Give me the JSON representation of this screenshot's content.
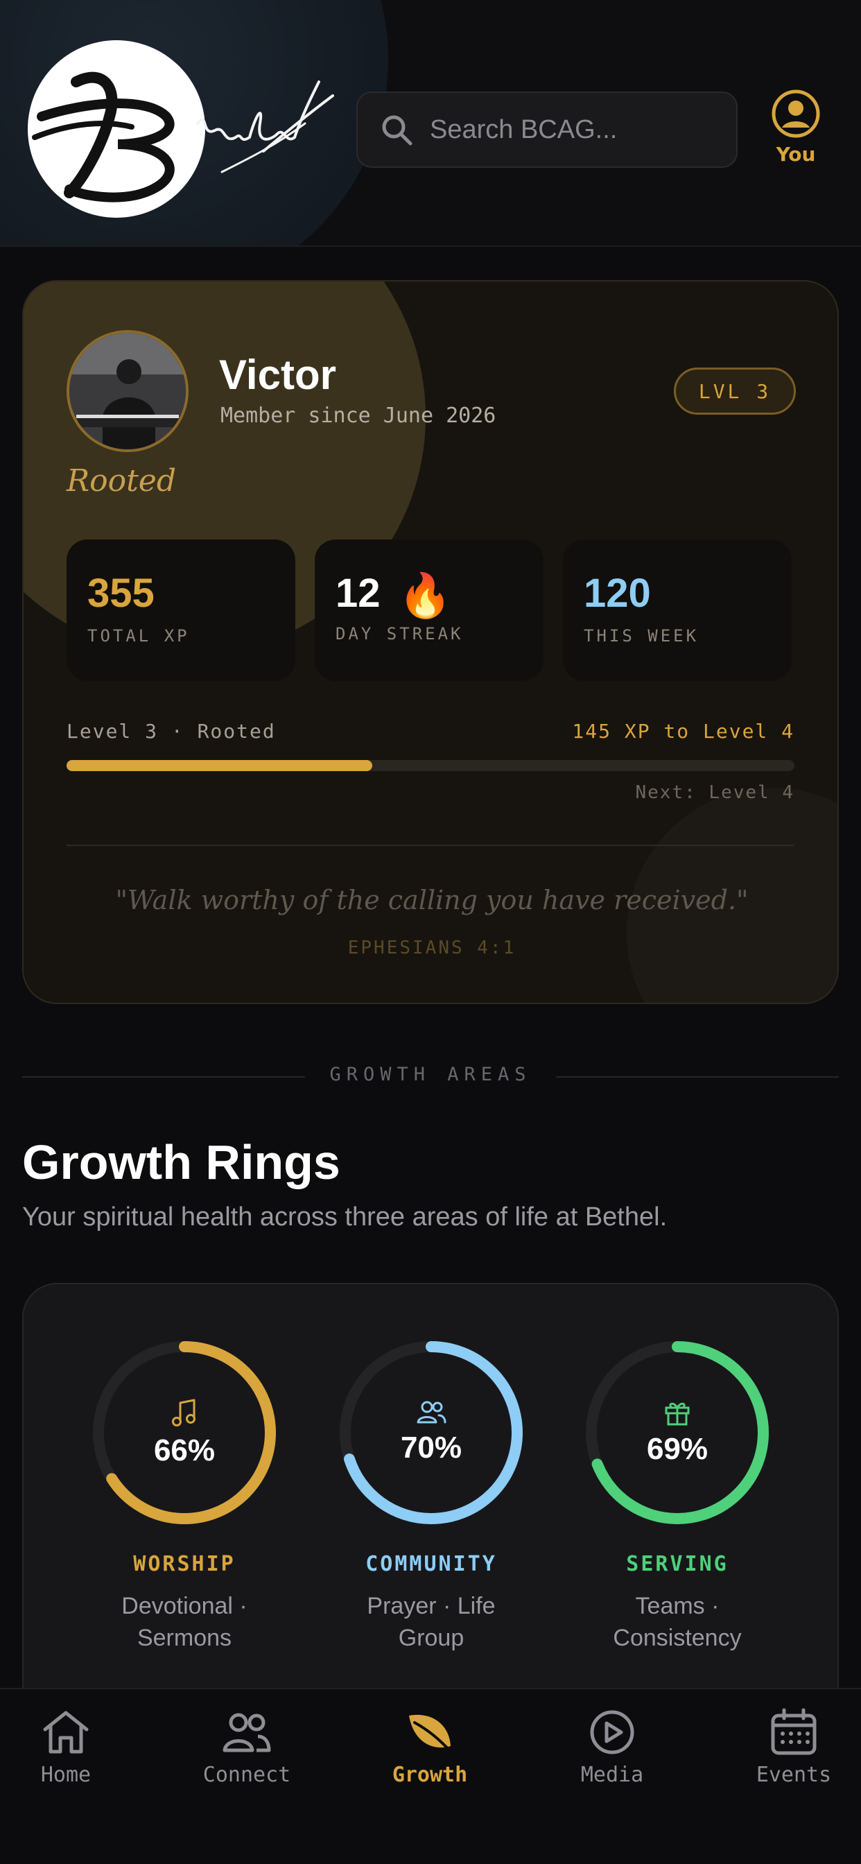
{
  "header": {
    "logo_text": "Bethel",
    "search_placeholder": "Search BCAG...",
    "profile_label": "You"
  },
  "profile": {
    "name": "Victor",
    "member_since": "Member since June 2026",
    "level_badge": "LVL 3",
    "rank": "Rooted",
    "stats": [
      {
        "value": "355",
        "label": "TOTAL XP",
        "color": "#d9a53d"
      },
      {
        "value": "12",
        "label": "DAY STREAK",
        "color": "#ffffff",
        "emoji": "🔥"
      },
      {
        "value": "120",
        "label": "THIS WEEK",
        "color": "#8ecdf5"
      }
    ],
    "level_text": "Level 3 · Rooted",
    "xp_to_next": "145 XP to Level 4",
    "progress": 0.42,
    "next_level": "Next: Level 4",
    "verse": "\"Walk worthy of the calling you have received.\"",
    "verse_ref": "EPHESIANS 4:1"
  },
  "growth": {
    "section_label": "GROWTH AREAS",
    "title": "Growth Rings",
    "subtitle": "Your spiritual health across three areas of life at Bethel.",
    "rings": [
      {
        "percent": 66,
        "label": "66%",
        "title": "WORSHIP",
        "desc_line1": "Devotional ·",
        "desc_line2": "Sermons",
        "color": "#d9a53d",
        "icon": "music-note-icon"
      },
      {
        "percent": 70,
        "label": "70%",
        "title": "COMMUNITY",
        "desc_line1": "Prayer · Life Group",
        "desc_line2": "",
        "color": "#8ecdf5",
        "icon": "people-icon"
      },
      {
        "percent": 69,
        "label": "69%",
        "title": "SERVING",
        "desc_line1": "Teams ·",
        "desc_line2": "Consistency",
        "color": "#4fd07a",
        "icon": "gift-icon"
      }
    ]
  },
  "nav": {
    "items": [
      {
        "label": "Home",
        "icon": "home-icon",
        "active": false
      },
      {
        "label": "Connect",
        "icon": "people-icon",
        "active": false
      },
      {
        "label": "Growth",
        "icon": "leaf-icon",
        "active": true
      },
      {
        "label": "Media",
        "icon": "play-icon",
        "active": false
      },
      {
        "label": "Events",
        "icon": "calendar-icon",
        "active": false
      }
    ]
  }
}
